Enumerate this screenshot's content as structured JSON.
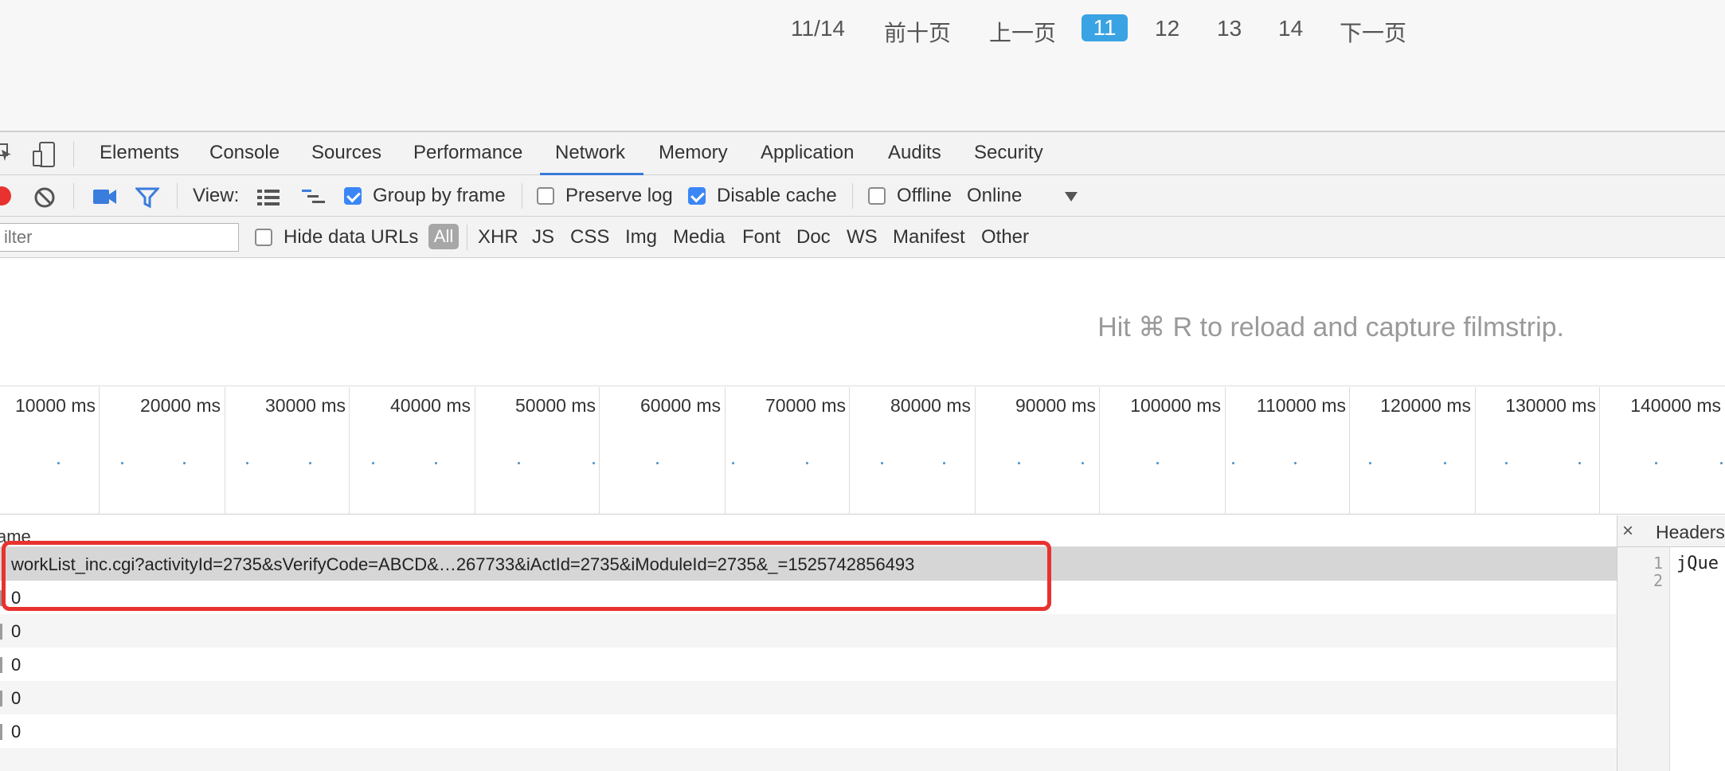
{
  "pagination": {
    "info": "11/14",
    "first_ten": "前十页",
    "prev": "上一页",
    "current": "11",
    "pages": [
      "12",
      "13",
      "14"
    ],
    "next": "下一页"
  },
  "devtools_tabs": [
    "Elements",
    "Console",
    "Sources",
    "Performance",
    "Network",
    "Memory",
    "Application",
    "Audits",
    "Security"
  ],
  "active_tab": "Network",
  "toolbar": {
    "view_label": "View:",
    "group_by_frame": "Group by frame",
    "group_by_frame_checked": true,
    "preserve_log": "Preserve log",
    "preserve_log_checked": false,
    "disable_cache": "Disable cache",
    "disable_cache_checked": true,
    "offline": "Offline",
    "offline_checked": false,
    "throttle": "Online"
  },
  "filter": {
    "placeholder": "ilter",
    "hide_data_urls": "Hide data URLs",
    "all": "All",
    "types": [
      "XHR",
      "JS",
      "CSS",
      "Img",
      "Media",
      "Font",
      "Doc",
      "WS",
      "Manifest",
      "Other"
    ]
  },
  "filmstrip_hint": "Hit ⌘ R to reload and capture filmstrip.",
  "timeline_labels": [
    "10000 ms",
    "20000 ms",
    "30000 ms",
    "40000 ms",
    "50000 ms",
    "60000 ms",
    "70000 ms",
    "80000 ms",
    "90000 ms",
    "100000 ms",
    "110000 ms",
    "120000 ms",
    "130000 ms",
    "140000 ms"
  ],
  "list": {
    "header": "ame",
    "rows": [
      "workList_inc.cgi?activityId=2735&sVerifyCode=ABCD&…267733&iActId=2735&iModuleId=2735&_=1525742856493",
      "0",
      "0",
      "0",
      "0",
      "0"
    ]
  },
  "right_panel": {
    "close": "×",
    "title": "Headers",
    "line_numbers": [
      "1",
      "2"
    ],
    "code_line": "jQue"
  },
  "colors": {
    "accent": "#3879d9",
    "highlight": "#e8322f",
    "pager_active": "#3aa3e3"
  }
}
